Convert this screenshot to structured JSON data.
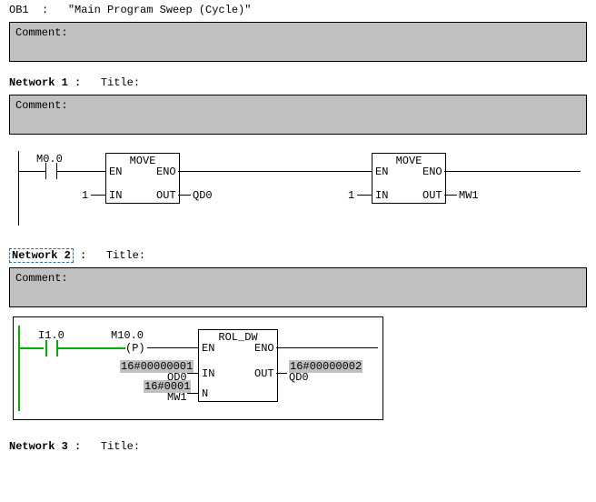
{
  "header": {
    "block": "OB1",
    "sep": ":",
    "title": "\"Main Program Sweep (Cycle)\""
  },
  "comment_label": "Comment:",
  "title_label": "Title:",
  "networks": [
    {
      "label": "Network 1",
      "selected": false
    },
    {
      "label": "Network 2",
      "selected": true
    },
    {
      "label": "Network 3",
      "selected": false
    }
  ],
  "net1": {
    "contact": "M0.0",
    "box1": {
      "name": "MOVE",
      "en": "EN",
      "eno": "ENO",
      "in": "IN",
      "out": "OUT",
      "in_val": "1",
      "out_sig": "QD0"
    },
    "box2": {
      "name": "MOVE",
      "en": "EN",
      "eno": "ENO",
      "in": "IN",
      "out": "OUT",
      "in_val": "1",
      "out_sig": "MW1"
    }
  },
  "net2": {
    "contact": "I1.0",
    "pcoil_addr": "M10.0",
    "pcoil_sym": "P",
    "box": {
      "name": "ROL_DW",
      "en": "EN",
      "eno": "ENO",
      "in": "IN",
      "out": "OUT",
      "n": "N",
      "in_val": "16#00000001",
      "in_sig": "QD0",
      "out_val": "16#00000002",
      "out_sig": "QD0",
      "n_val": "16#0001",
      "n_sig": "MW1"
    }
  }
}
